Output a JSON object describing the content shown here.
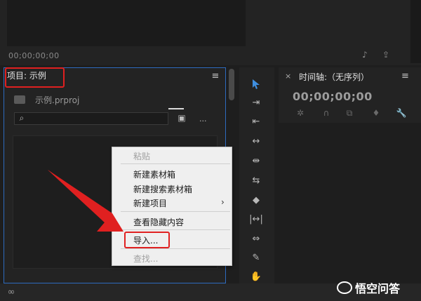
{
  "source_monitor": {
    "timecode": "00;00;00;00"
  },
  "project": {
    "tab_label": "项目: 示例",
    "file_name": "示例.prproj",
    "search_placeholder": "",
    "more_label": "..."
  },
  "timeline": {
    "close_label": "×",
    "title": "时间轴:（无序列）",
    "timecode": "00;00;00;00"
  },
  "context_menu": {
    "items": [
      {
        "label": "粘贴",
        "enabled": false
      },
      {
        "label": "新建素材箱",
        "enabled": true
      },
      {
        "label": "新建搜索素材箱",
        "enabled": true
      },
      {
        "label": "新建项目",
        "enabled": true,
        "submenu": true
      },
      {
        "label": "查看隐藏内容",
        "enabled": true
      },
      {
        "label": "导入...",
        "enabled": true
      },
      {
        "label": "查找...",
        "enabled": false
      }
    ],
    "submenu_arrow": "›"
  },
  "branding": {
    "label": "悟空问答"
  },
  "colors": {
    "annotation_red": "#e02020",
    "panel_focus_border": "#2e6bbf",
    "selection_tool": "#3f8fe0"
  },
  "icons": {
    "panel_menu": "≡",
    "selection_tool": "▲",
    "search": "⌕"
  }
}
